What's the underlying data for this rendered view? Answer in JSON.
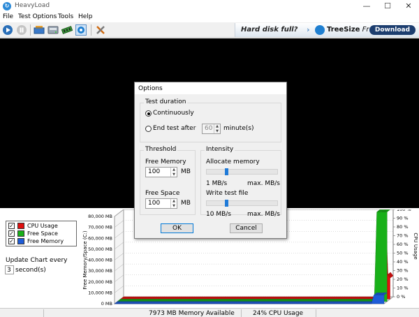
{
  "window": {
    "title": "HeavyLoad",
    "app_icon_glyph": "↻"
  },
  "menu": [
    "File",
    "Test Options",
    "Tools",
    "Help"
  ],
  "toolbar": {
    "icons": [
      "start-icon",
      "pause-icon",
      "cpu-icon",
      "disk-icon",
      "memory-icon",
      "gpu-icon",
      "tools-icon"
    ]
  },
  "ad": {
    "text": "Hard disk full?",
    "brand_bold": "TreeSize",
    "brand_rest": " Free",
    "download_label": "Download"
  },
  "legend": {
    "items": [
      {
        "label": "CPU Usage",
        "color": "#e01010",
        "checked": true
      },
      {
        "label": "Free Space",
        "color": "#18b018",
        "checked": true
      },
      {
        "label": "Free Memory",
        "color": "#1e5cd8",
        "checked": true
      }
    ],
    "check_glyph": "✓"
  },
  "update": {
    "label": "Update Chart every",
    "value": "3",
    "unit": "second(s)"
  },
  "chart_data": {
    "type": "area",
    "left_axis_label": "Free Memory/Space (C:)",
    "left_ticks": [
      "80,000 MB",
      "70,000 MB",
      "60,000 MB",
      "50,000 MB",
      "40,000 MB",
      "30,000 MB",
      "20,000 MB",
      "10,000 MB",
      "0 MB"
    ],
    "right_axis_label": "CPU Usage",
    "right_ticks": [
      "100 %",
      "90 %",
      "80 %",
      "70 %",
      "60 %",
      "50 %",
      "40 %",
      "30 %",
      "20 %",
      "10 %",
      "0 %"
    ],
    "ylim_memory_mb": [
      0,
      80000
    ],
    "ylim_cpu_percent": [
      0,
      100
    ],
    "series": [
      {
        "name": "CPU Usage",
        "color": "#e01010",
        "values": [
          0,
          0,
          0,
          0,
          0,
          0,
          0,
          0,
          0,
          0,
          0,
          0,
          0,
          0,
          0,
          0,
          0,
          0,
          0,
          0,
          0,
          0,
          0,
          0,
          0,
          0,
          0,
          0,
          0,
          0,
          0,
          0,
          0,
          0,
          0,
          0,
          0,
          0,
          0,
          0,
          0,
          0,
          0,
          0,
          0,
          0,
          0,
          0,
          0,
          0,
          0,
          0,
          0,
          0,
          0,
          0,
          0,
          0,
          0,
          0,
          0,
          0,
          0,
          0,
          0,
          0,
          0,
          0,
          0,
          0,
          0,
          0,
          0,
          0,
          0,
          0,
          0,
          0,
          0,
          0,
          0,
          0,
          0,
          0,
          0,
          0,
          0,
          0,
          0,
          0,
          0,
          0,
          0,
          0,
          0,
          0,
          0,
          0,
          0,
          0,
          0,
          0,
          0,
          100,
          24,
          28,
          24
        ]
      },
      {
        "name": "Free Space",
        "color": "#18b018",
        "values": [
          0,
          0,
          0,
          0,
          0,
          0,
          0,
          0,
          0,
          0,
          0,
          0,
          0,
          0,
          0,
          0,
          0,
          0,
          0,
          0,
          0,
          0,
          0,
          0,
          0,
          0,
          0,
          0,
          0,
          0,
          0,
          0,
          0,
          0,
          0,
          0,
          0,
          0,
          0,
          0,
          0,
          0,
          0,
          0,
          0,
          0,
          0,
          0,
          0,
          0,
          0,
          0,
          0,
          0,
          0,
          0,
          0,
          0,
          0,
          0,
          0,
          0,
          0,
          0,
          0,
          0,
          0,
          0,
          0,
          0,
          0,
          0,
          0,
          0,
          0,
          0,
          0,
          0,
          0,
          0,
          0,
          0,
          0,
          0,
          0,
          0,
          0,
          0,
          0,
          0,
          0,
          0,
          0,
          0,
          0,
          0,
          0,
          0,
          0,
          0,
          0,
          0,
          82000,
          82000,
          82000,
          82000,
          82000
        ]
      },
      {
        "name": "Free Memory",
        "color": "#1e5cd8",
        "values": [
          0,
          0,
          0,
          0,
          0,
          0,
          0,
          0,
          0,
          0,
          0,
          0,
          0,
          0,
          0,
          0,
          0,
          0,
          0,
          0,
          0,
          0,
          0,
          0,
          0,
          0,
          0,
          0,
          0,
          0,
          0,
          0,
          0,
          0,
          0,
          0,
          0,
          0,
          0,
          0,
          0,
          0,
          0,
          0,
          0,
          0,
          0,
          0,
          0,
          0,
          0,
          0,
          0,
          0,
          0,
          0,
          0,
          0,
          0,
          0,
          0,
          0,
          0,
          0,
          0,
          0,
          0,
          0,
          0,
          0,
          0,
          0,
          0,
          0,
          0,
          0,
          0,
          0,
          0,
          0,
          0,
          0,
          0,
          0,
          0,
          0,
          0,
          0,
          0,
          0,
          0,
          0,
          0,
          0,
          0,
          0,
          0,
          0,
          0,
          0,
          0,
          0,
          7973,
          7973,
          7973,
          7973,
          7973
        ]
      }
    ],
    "grid": true
  },
  "status": {
    "memory": "7973 MB Memory Available",
    "cpu": "24% CPU Usage"
  },
  "dialog": {
    "title": "Options",
    "duration": {
      "title": "Test duration",
      "continuously_label": "Continuously",
      "end_label": "End test after",
      "end_value": "60",
      "end_unit": "minute(s)",
      "selected": "continuously"
    },
    "threshold": {
      "title": "Threshold",
      "free_memory_label": "Free Memory",
      "free_memory_value": "100",
      "free_memory_unit": "MB",
      "free_space_label": "Free Space",
      "free_space_value": "100",
      "free_space_unit": "MB"
    },
    "intensity": {
      "title": "Intensity",
      "allocate_label": "Allocate memory",
      "allocate_min": "1 MB/s",
      "allocate_max": "max. MB/s",
      "allocate_level": 0.27,
      "write_label": "Write test file",
      "write_min": "10 MB/s",
      "write_max": "max. MB/s",
      "write_level": 0.27
    },
    "ok_label": "OK",
    "cancel_label": "Cancel"
  }
}
